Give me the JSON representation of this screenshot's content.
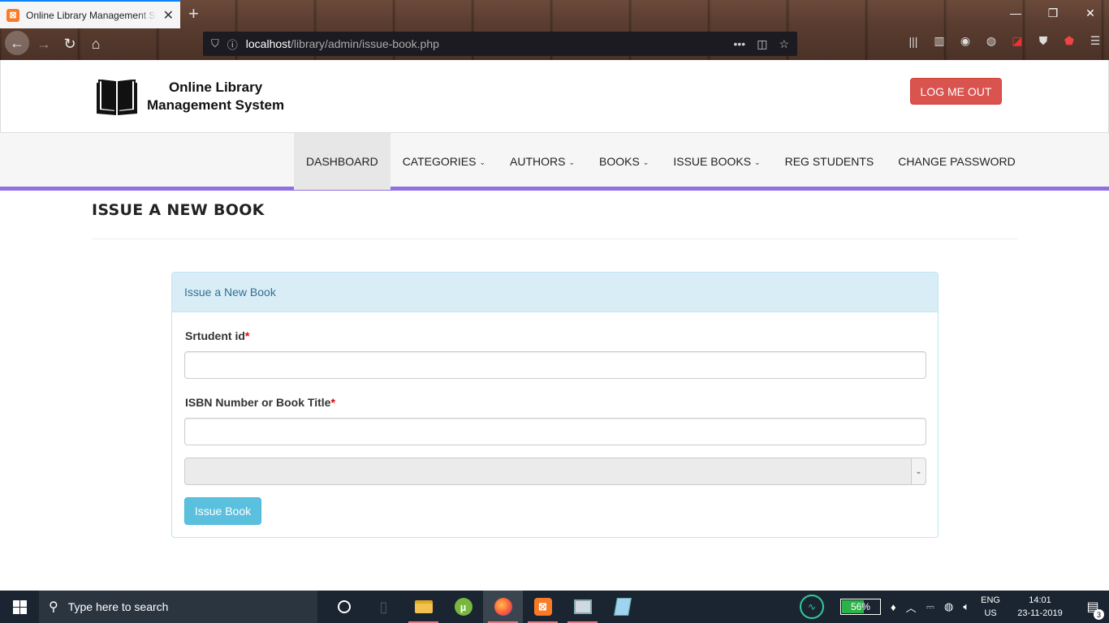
{
  "browser": {
    "tab_title": "Online Library Management System",
    "favicon": "xampp-icon",
    "url_host": "localhost",
    "url_path": "/library/admin/issue-book.php"
  },
  "header": {
    "logo_line1": "Online Library",
    "logo_line2": "Management System",
    "logout_label": "LOG ME OUT"
  },
  "menu": {
    "items": [
      {
        "label": "DASHBOARD",
        "dropdown": false,
        "active": true
      },
      {
        "label": "CATEGORIES",
        "dropdown": true
      },
      {
        "label": "AUTHORS",
        "dropdown": true
      },
      {
        "label": "BOOKS",
        "dropdown": true
      },
      {
        "label": "ISSUE BOOKS",
        "dropdown": true
      },
      {
        "label": "REG STUDENTS",
        "dropdown": false
      },
      {
        "label": "CHANGE PASSWORD",
        "dropdown": false
      }
    ]
  },
  "page": {
    "title": "ISSUE A NEW BOOK",
    "panel_heading": "Issue a New Book",
    "student_label": "Srtudent id",
    "student_value": "",
    "isbn_label": "ISBN Number or Book Title",
    "isbn_value": "",
    "required_mark": "*",
    "select_value": "",
    "submit_label": "Issue Book"
  },
  "taskbar": {
    "search_placeholder": "Type here to search",
    "battery": "56%",
    "battery_level": 0.56,
    "lang_line1": "ENG",
    "lang_line2": "US",
    "time": "14:01",
    "date": "23-11-2019",
    "notification_count": "3"
  },
  "colors": {
    "menu_accent": "#9170e0",
    "logout": "#d9534f",
    "issue_button": "#5bc0de",
    "panel_heading_bg": "#d9edf7"
  }
}
